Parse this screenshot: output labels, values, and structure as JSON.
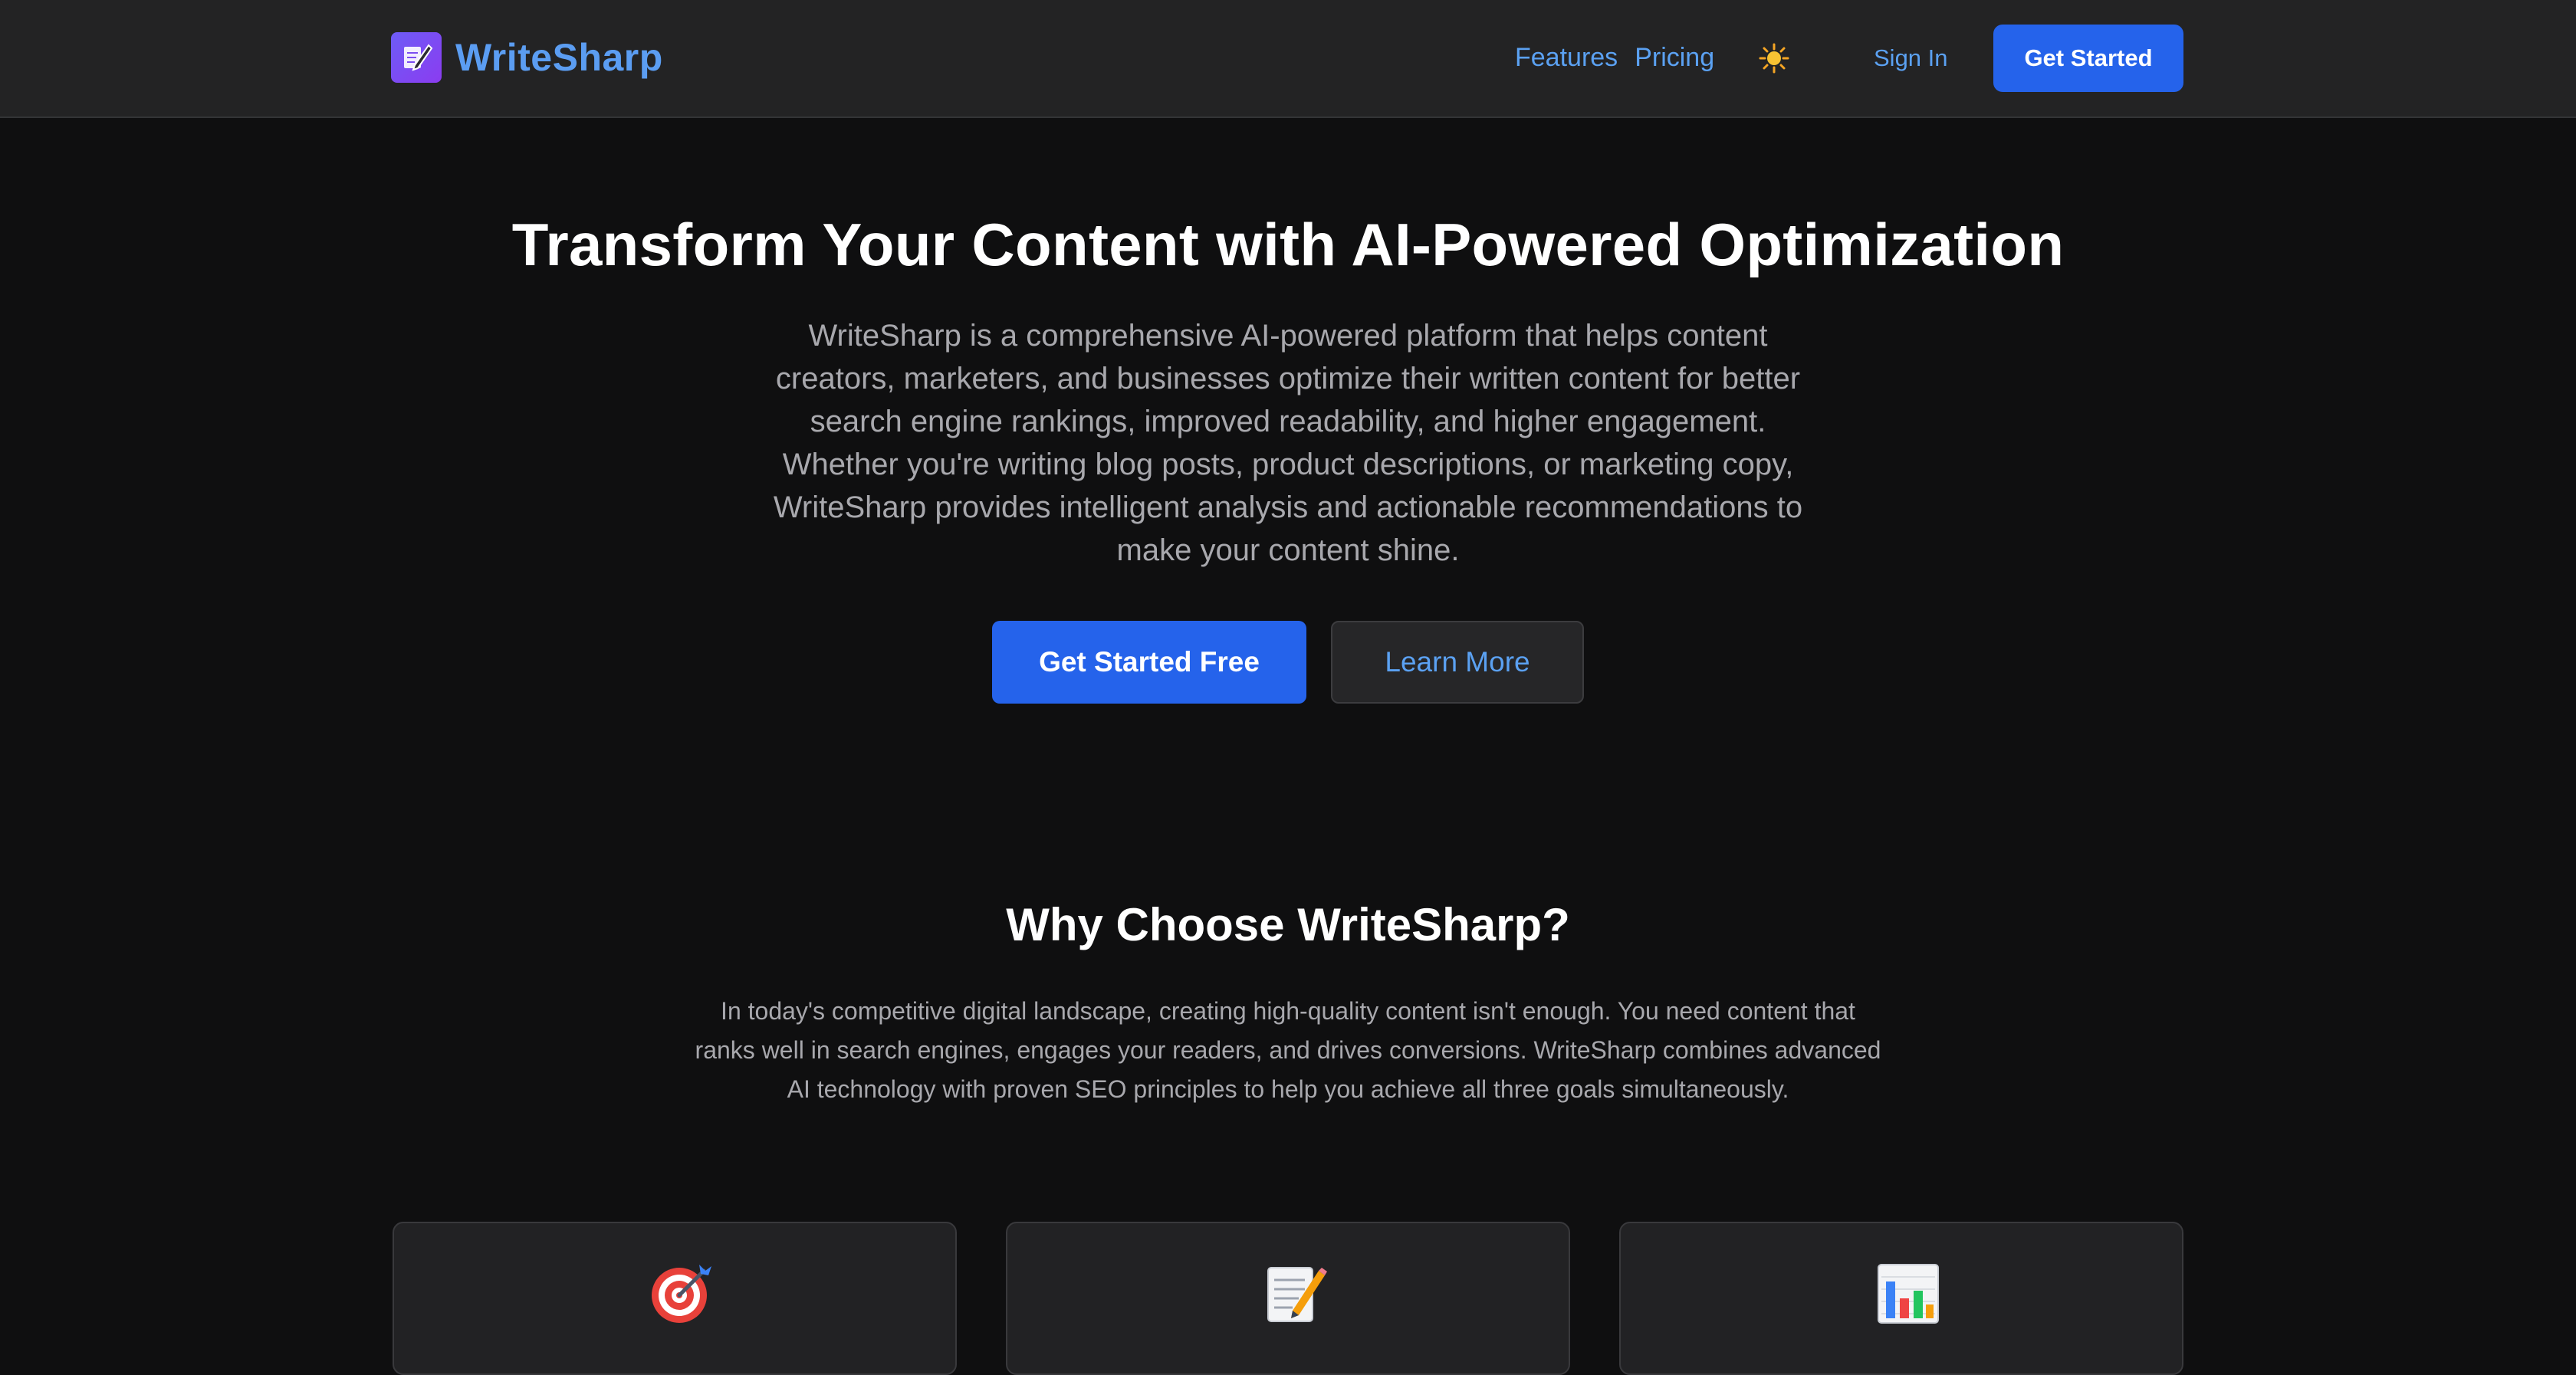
{
  "header": {
    "brand": "WriteSharp",
    "logo_icon": "pen-writing-icon",
    "nav": [
      {
        "label": "Features"
      },
      {
        "label": "Pricing"
      }
    ],
    "theme_toggle_icon": "sun-icon",
    "sign_in_label": "Sign In",
    "get_started_label": "Get Started"
  },
  "hero": {
    "title": "Transform Your Content with AI-Powered Optimization",
    "description": "WriteSharp is a comprehensive AI-powered platform that helps content creators, marketers, and businesses optimize their written content for better search engine rankings, improved readability, and higher engagement. Whether you're writing blog posts, product descriptions, or marketing copy, WriteSharp provides intelligent analysis and actionable recommendations to make your content shine.",
    "primary_cta": "Get Started Free",
    "secondary_cta": "Learn More"
  },
  "why": {
    "title": "Why Choose WriteSharp?",
    "description": "In today's competitive digital landscape, creating high-quality content isn't enough. You need content that ranks well in search engines, engages your readers, and drives conversions. WriteSharp combines advanced AI technology with proven SEO principles to help you achieve all three goals simultaneously."
  },
  "features": [
    {
      "icon": "target-icon"
    },
    {
      "icon": "memo-icon"
    },
    {
      "icon": "bar-chart-icon"
    }
  ],
  "colors": {
    "accent": "#2563eb",
    "link": "#5ba1f2",
    "background": "#0f0f10",
    "header_bg": "#232324"
  }
}
